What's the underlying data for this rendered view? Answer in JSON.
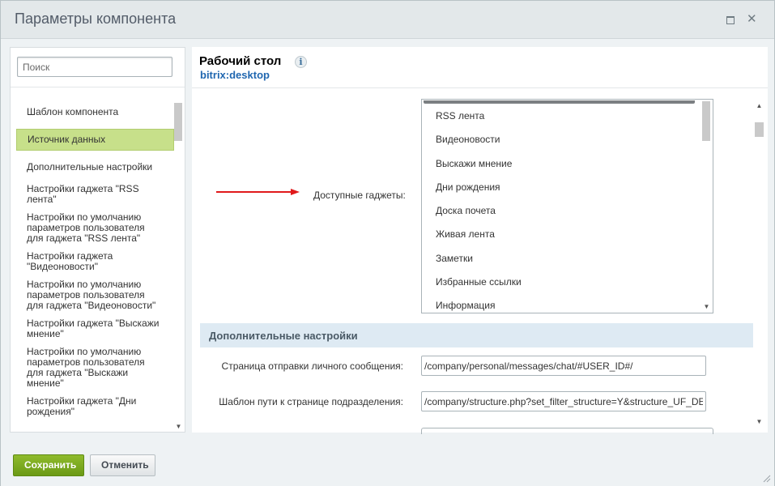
{
  "dialog": {
    "title": "Параметры компонента"
  },
  "left_panel": {
    "search_placeholder": "Поиск",
    "items": [
      "Шаблон компонента",
      "Источник данных",
      "Дополнительные настройки",
      "Настройки гаджета \"RSS лента\"",
      "Настройки по умолчанию параметров пользователя для гаджета \"RSS лента\"",
      "Настройки гаджета \"Видеоновости\"",
      "Настройки по умолчанию параметров пользователя для гаджета \"Видеоновости\"",
      "Настройки гаджета \"Выскажи мнение\"",
      "Настройки по умолчанию параметров пользователя для гаджета \"Выскажи мнение\"",
      "Настройки гаджета \"Дни рождения\""
    ],
    "active_item": "Источник данных"
  },
  "component": {
    "title": "Рабочий стол",
    "code": "bitrix:desktop"
  },
  "gadgets": {
    "label": "Доступные гаджеты:",
    "options": [
      "RSS лента",
      "Видеоновости",
      "Выскажи мнение",
      "Дни рождения",
      "Доска почета",
      "Живая лента",
      "Заметки",
      "Избранные ссылки",
      "Информация"
    ]
  },
  "extra_settings": {
    "section_title": "Дополнительные настройки",
    "fields": [
      {
        "label": "Страница отправки личного сообщения:",
        "value": "/company/personal/messages/chat/#USER_ID#/"
      },
      {
        "label": "Шаблон пути к странице подразделения:",
        "value": "/company/structure.php?set_filter_structure=Y&structure_UF_DEPARTMENT=#ID#"
      }
    ]
  },
  "footer": {
    "save_label": "Сохранить",
    "cancel_label": "Отменить"
  },
  "colors": {
    "active_item_bg": "#c7e08a",
    "section_bg": "#deeaf3",
    "save_button": "#7aa91d",
    "arrow": "#e0191b",
    "link": "#2067b0"
  }
}
